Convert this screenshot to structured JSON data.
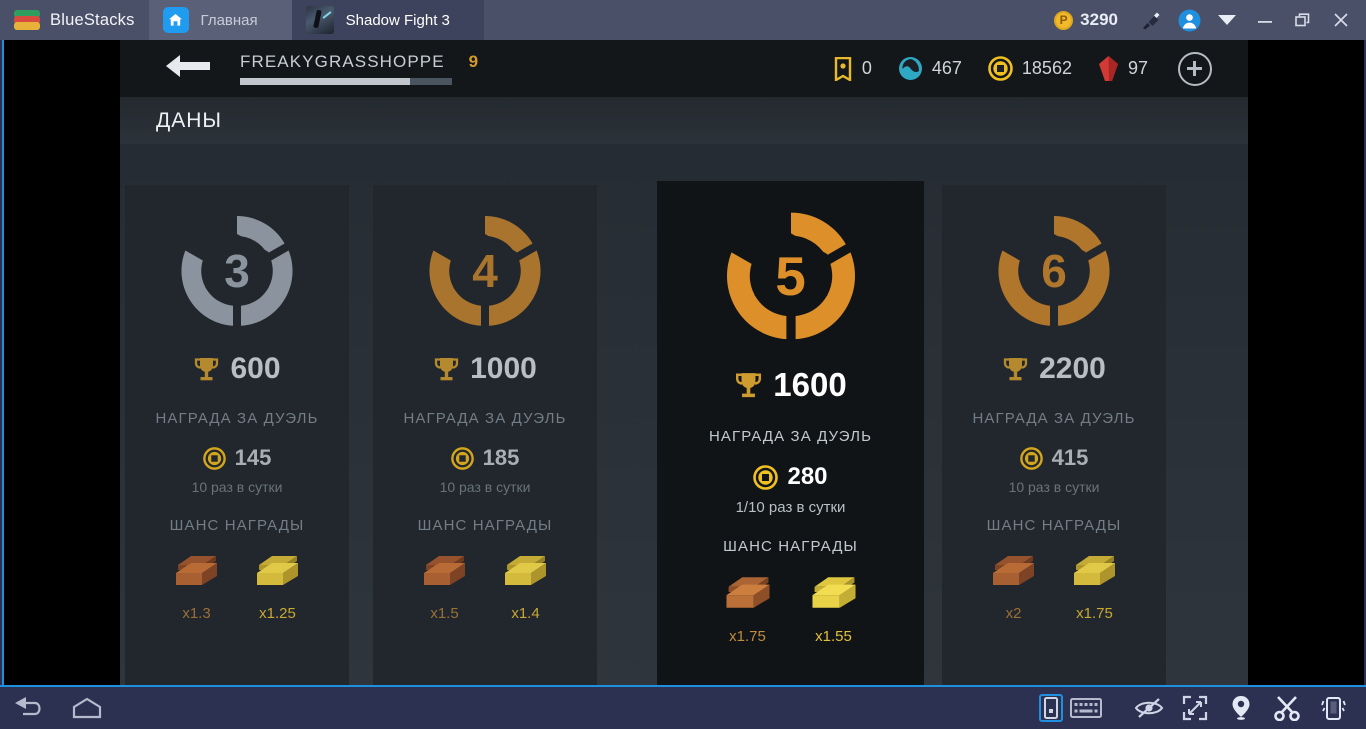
{
  "titlebar": {
    "brand": "BlueStacks",
    "tabs": [
      {
        "label": "Главная",
        "icon": "home-icon"
      },
      {
        "label": "Shadow Fight 3",
        "icon": "game-thumbnail"
      }
    ],
    "bluestacks_points": "3290",
    "buttons": [
      {
        "name": "brush-icon"
      },
      {
        "name": "account-avatar-icon"
      },
      {
        "name": "chevron-down-icon"
      },
      {
        "name": "minimize-icon"
      },
      {
        "name": "restore-icon"
      },
      {
        "name": "close-icon"
      }
    ]
  },
  "game": {
    "back_icon": "back-arrow-icon",
    "player": {
      "name": "FREAKYGRASSHOPPE",
      "level": "9",
      "xp_percent": 80
    },
    "currencies": [
      {
        "icon": "ticket-icon",
        "value": "0",
        "color": "#e8b92c"
      },
      {
        "icon": "shadow-energy-icon",
        "value": "467",
        "color": "#2fa8c4"
      },
      {
        "icon": "gold-coin-icon",
        "value": "18562",
        "color": "#f0c021"
      },
      {
        "icon": "ruby-gem-icon",
        "value": "97",
        "color": "#d23a35"
      }
    ],
    "add_button": "plus-button",
    "section_title": "ДАНЫ",
    "cards": [
      {
        "rank": "3",
        "tier_color": "#8b949e",
        "trophies": "600",
        "duel_reward_label": "НАГРАДА ЗА ДУЭЛЬ",
        "coins": "145",
        "limit": "10 раз в сутки",
        "chance_label": "ШАНС НАГРАДЫ",
        "chests": [
          {
            "type": "bronze-chest",
            "multiplier": "x1.3"
          },
          {
            "type": "gold-chest",
            "multiplier": "x1.25"
          }
        ],
        "active": false
      },
      {
        "rank": "4",
        "tier_color": "#a9742e",
        "trophies": "1000",
        "duel_reward_label": "НАГРАДА ЗА ДУЭЛЬ",
        "coins": "185",
        "limit": "10 раз в сутки",
        "chance_label": "ШАНС НАГРАДЫ",
        "chests": [
          {
            "type": "bronze-chest",
            "multiplier": "x1.5"
          },
          {
            "type": "gold-chest",
            "multiplier": "x1.4"
          }
        ],
        "active": false
      },
      {
        "rank": "5",
        "tier_color": "#dd8f2a",
        "trophies": "1600",
        "duel_reward_label": "НАГРАДА ЗА ДУЭЛЬ",
        "coins": "280",
        "limit": "1/10 раз в сутки",
        "chance_label": "ШАНС НАГРАДЫ",
        "chests": [
          {
            "type": "bronze-chest",
            "multiplier": "x1.75"
          },
          {
            "type": "gold-chest",
            "multiplier": "x1.55"
          }
        ],
        "active": true
      },
      {
        "rank": "6",
        "tier_color": "#b0762c",
        "trophies": "2200",
        "duel_reward_label": "НАГРАДА ЗА ДУЭЛЬ",
        "coins": "415",
        "limit": "10 раз в сутки",
        "chance_label": "ШАНС НАГРАДЫ",
        "chests": [
          {
            "type": "bronze-chest",
            "multiplier": "x2"
          },
          {
            "type": "gold-chest",
            "multiplier": "x1.75"
          }
        ],
        "active": false
      }
    ]
  },
  "bottombar": {
    "left": [
      {
        "name": "back-nav-icon"
      },
      {
        "name": "home-nav-icon"
      }
    ],
    "right": [
      {
        "name": "portrait-mode-icon",
        "highlighted": true
      },
      {
        "name": "keyboard-icon",
        "highlighted": false
      },
      {
        "name": "eye-off-icon",
        "highlighted": false
      },
      {
        "name": "fullscreen-icon",
        "highlighted": false
      },
      {
        "name": "location-pin-icon",
        "highlighted": false
      },
      {
        "name": "scissors-icon",
        "highlighted": false
      },
      {
        "name": "shake-device-icon",
        "highlighted": false
      }
    ]
  },
  "colors": {
    "accent_blue": "#1f8fe0",
    "gold": "#e8b92c",
    "active_orange": "#dd8f2a"
  }
}
